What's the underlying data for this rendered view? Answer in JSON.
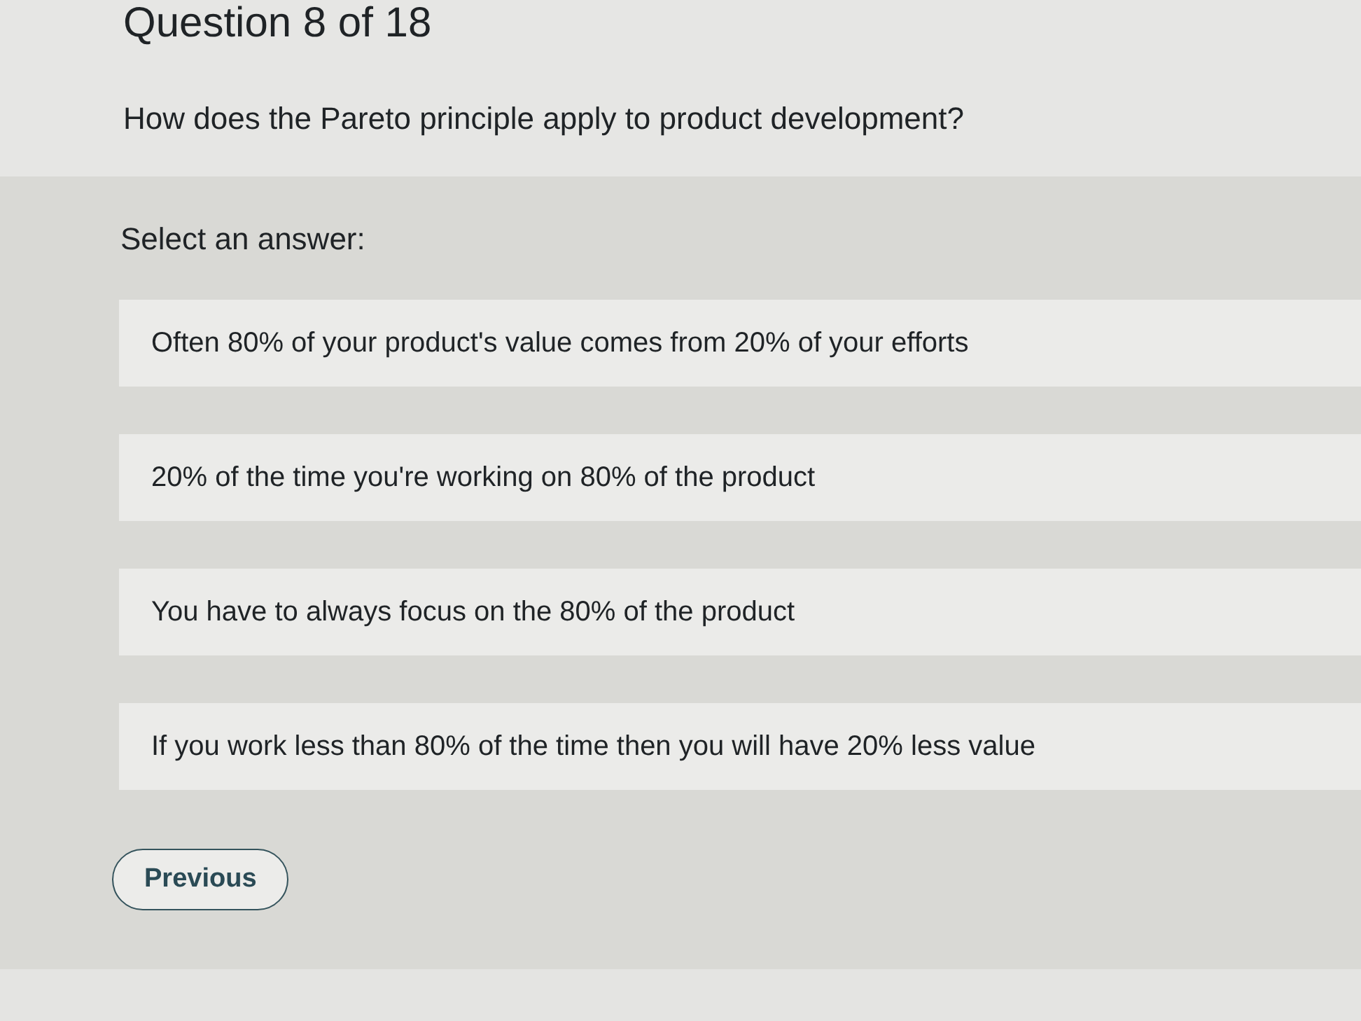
{
  "header": {
    "title": "Question 8 of 18",
    "question": "How does the Pareto principle apply to product development?"
  },
  "answers": {
    "prompt": "Select an answer:",
    "options": [
      {
        "text": "Often 80% of your product's value comes from 20% of your efforts",
        "selected": false
      },
      {
        "text": "20% of the time you're working on 80% of the product",
        "selected": false
      },
      {
        "text": "You have to always focus on the 80% of the product",
        "selected": false
      },
      {
        "text": "If you work less than 80% of the time then you will have 20% less value",
        "selected": false
      }
    ]
  },
  "buttons": [
    {
      "label": "Previous",
      "kind": "secondary"
    }
  ]
}
